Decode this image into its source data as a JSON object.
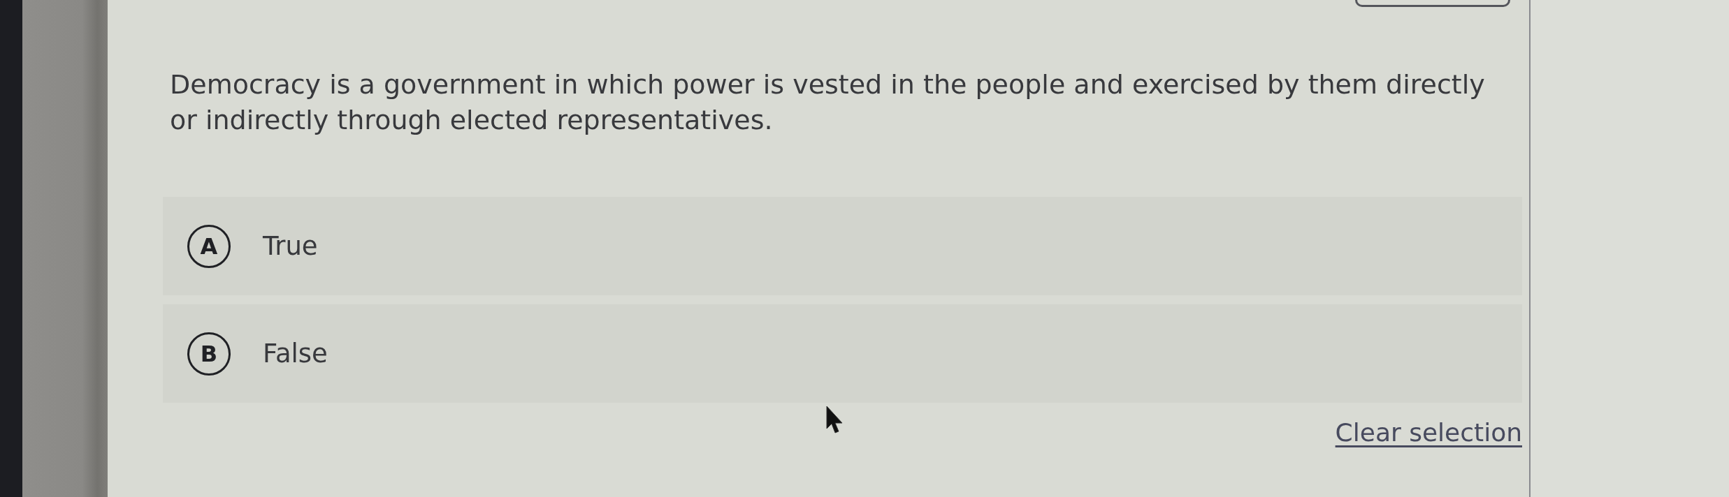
{
  "question": {
    "text": "Democracy is a government in which power is vested in the people and exercised by them directly or indirectly through elected representatives."
  },
  "options": [
    {
      "letter": "A",
      "label": "True",
      "selected": false
    },
    {
      "letter": "B",
      "label": "False",
      "selected": false
    }
  ],
  "clear_selection": {
    "label": "Clear selection"
  }
}
